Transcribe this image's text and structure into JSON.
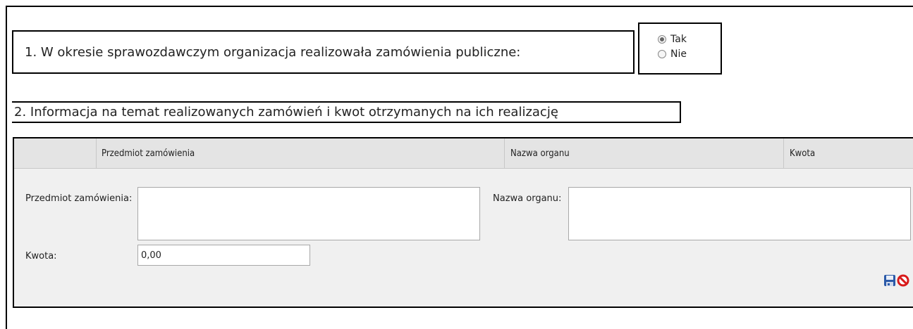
{
  "question1": {
    "text": "1. W okresie sprawozdawczym organizacja realizowała zamówienia publiczne:",
    "options": [
      {
        "label": "Tak",
        "selected": true
      },
      {
        "label": "Nie",
        "selected": false
      }
    ]
  },
  "question2": {
    "text": "2. Informacja na temat realizowanych zamówień i kwot otrzymanych na ich realizację"
  },
  "grid": {
    "columns": [
      "Przedmiot zamówienia",
      "Nazwa organu",
      "Kwota"
    ],
    "form": {
      "subject_label": "Przedmiot zamówienia:",
      "subject_value": "",
      "authority_label": "Nazwa organu:",
      "authority_value": "",
      "amount_label": "Kwota:",
      "amount_value": "0,00"
    },
    "icons": [
      "save-icon",
      "cancel-icon"
    ]
  }
}
